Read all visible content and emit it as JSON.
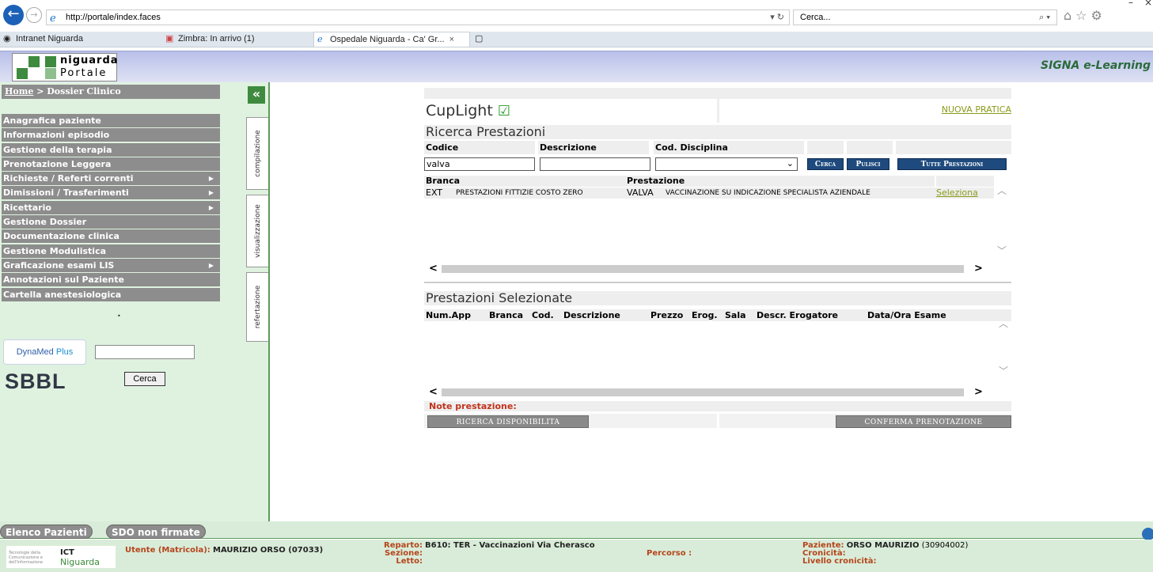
{
  "browser": {
    "url": "http://portale/index.faces",
    "search_placeholder": "Cerca...",
    "tabs": [
      {
        "label": "Intranet Niguarda"
      },
      {
        "label": "Zimbra: In arrivo (1)"
      },
      {
        "label": "Ospedale Niguarda - Ca' Gr..."
      }
    ]
  },
  "banner": {
    "logo_line1": "niguarda",
    "logo_line2": "Portale",
    "right_text": "SIGNA e-Learning"
  },
  "sidebar": {
    "breadcrumb_home": "Home",
    "breadcrumb_sep": " > ",
    "breadcrumb_current": "Dossier Clinico",
    "items": [
      {
        "label": "Anagrafica paziente",
        "submenu": false
      },
      {
        "label": "Informazioni episodio",
        "submenu": false
      },
      {
        "label": "Gestione della terapia",
        "submenu": false
      },
      {
        "label": "Prenotazione Leggera",
        "submenu": false
      },
      {
        "label": "Richieste / Referti correnti",
        "submenu": true
      },
      {
        "label": "Dimissioni / Trasferimenti",
        "submenu": true
      },
      {
        "label": "Ricettario",
        "submenu": true
      },
      {
        "label": "Gestione Dossier",
        "submenu": false
      },
      {
        "label": "Documentazione clinica",
        "submenu": false
      },
      {
        "label": "Gestione Modulistica",
        "submenu": false
      },
      {
        "label": "Graficazione esami LIS",
        "submenu": true
      },
      {
        "label": "Annotazioni sul Paziente",
        "submenu": false
      },
      {
        "label": "Cartella anestesiologica",
        "submenu": false
      }
    ],
    "vtabs": [
      "compilazione",
      "visualizzazione",
      "refertazione"
    ],
    "dynamed_label": "DynaMed",
    "dynamed_plus": "Plus",
    "sbbl_label": "SBBL",
    "cerca_label": "Cerca"
  },
  "main": {
    "title": "CupLight",
    "nuova_pratica": "NUOVA PRATICA",
    "ricerca_title": "Ricerca Prestazioni",
    "fields": {
      "codice_label": "Codice",
      "descrizione_label": "Descrizione",
      "disciplina_label": "Cod. Disciplina",
      "codice_value": "valva",
      "descrizione_value": "",
      "disciplina_value": ""
    },
    "buttons": {
      "cerca": "Cerca",
      "pulisci": "Pulisci",
      "tutte": "Tutte Prestazioni"
    },
    "results": {
      "headers": {
        "branca": "Branca",
        "prestazione": "Prestazione"
      },
      "rows": [
        {
          "branca_code": "EXT",
          "branca_desc": "PRESTAZIONI FITTIZIE COSTO ZERO",
          "prest_code": "VALVA",
          "prest_desc": "VACCINAZIONE SU INDICAZIONE SPECIALISTA AZIENDALE",
          "action": "Seleziona"
        }
      ]
    },
    "selezionate_title": "Prestazioni Selezionate",
    "selezionate_headers": [
      "Num.App",
      "Branca",
      "Cod.",
      "Descrizione",
      "Prezzo",
      "Erog.",
      "Sala",
      "Descr. Erogatore",
      "Data/Ora Esame"
    ],
    "note_label": "Note prestazione:",
    "ricerca_disponibilita": "RICERCA DISPONIBILITA",
    "conferma_prenotazione": "CONFERMA PRENOTAZIONE"
  },
  "footer": {
    "tab_elenco": "Elenco Pazienti",
    "tab_sdo": "SDO non firmate",
    "ict_small": "Tecnologie della Comunicazione e dell'Informazione",
    "ict_title": "ICT",
    "ict_sub": "Niguarda",
    "utente_label": "Utente (Matricola):",
    "utente_value": "MAURIZIO ORSO (07033)",
    "reparto_label": "Reparto:",
    "reparto_value": "B610: TER - Vaccinazioni Via Cherasco",
    "sezione_label": "Sezione:",
    "letto_label": "Letto:",
    "percorso_label": "Percorso :",
    "paziente_label": "Paziente:",
    "paziente_name": "ORSO MAURIZIO",
    "paziente_id": "(30904002)",
    "cronicita_label": "Cronicità:",
    "livello_label": "Livello cronicità:"
  }
}
